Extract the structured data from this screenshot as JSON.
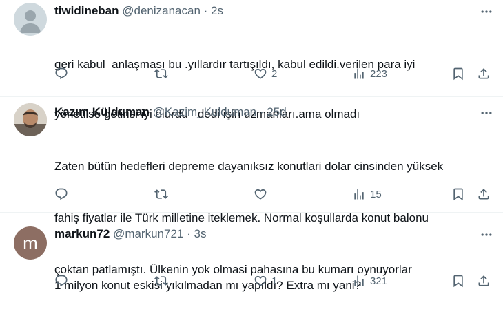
{
  "tweets": [
    {
      "name": "tiwidineban",
      "handle": "@denizanacan",
      "sep": "·",
      "time": "2s",
      "lines": [
        "geri kabul  anlaşması bu .yıllardır tartışıldı, kabul edildi.verilen para iyi",
        "yönetilse getirisi iyi olurdu   dedi işin uzmanları.ama olmadı"
      ],
      "likes": "2",
      "views": "223"
    },
    {
      "name": "Kazım Külduman",
      "handle": "@Kazim_Kulduman",
      "sep": "·",
      "time": "25d",
      "lines": [
        "Zaten bütün hedefleri depreme dayanıksız konutlari dolar cinsinden yüksek",
        "fahiş fiyatlar ile Türk milletine iteklemek. Normal koşullarda konut balonu",
        "çoktan patlamıştı. Ülkenin yok olmasi pahasına bu kumarı oynuyorlar"
      ],
      "likes": "",
      "views": "15"
    },
    {
      "name": "markun72",
      "handle": "@markun721",
      "sep": "·",
      "time": "3s",
      "avatar_letter": "m",
      "lines": [
        "1 milyon konut eskisi yıkılmadan mı yapıldı? Extra mı yani?"
      ],
      "likes": "1",
      "views": "321"
    }
  ],
  "icons": [
    "more-icon",
    "reply-icon",
    "retweet-icon",
    "like-icon",
    "views-icon",
    "bookmark-icon",
    "share-icon"
  ],
  "colors": {
    "text": "#0f1419",
    "muted": "#536471",
    "divider": "#eff3f4"
  }
}
